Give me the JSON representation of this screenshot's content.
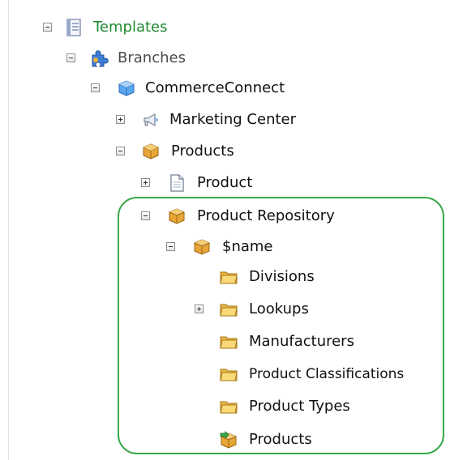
{
  "tree": {
    "templates": {
      "label": "Templates",
      "expanded": true
    },
    "branches": {
      "label": "Branches",
      "expanded": true
    },
    "commerce_connect": {
      "label": "CommerceConnect",
      "expanded": true
    },
    "marketing_center": {
      "label": "Marketing Center",
      "expanded": false
    },
    "products": {
      "label": "Products",
      "expanded": true
    },
    "product": {
      "label": "Product",
      "expanded": false
    },
    "product_repository": {
      "label": "Product Repository",
      "expanded": true
    },
    "name": {
      "label": "$name",
      "expanded": true
    },
    "divisions": {
      "label": "Divisions"
    },
    "lookups": {
      "label": "Lookups",
      "expanded": false
    },
    "manufacturers": {
      "label": "Manufacturers"
    },
    "product_classifications": {
      "label": "Product Classifications"
    },
    "product_types": {
      "label": "Product Types"
    },
    "products_child": {
      "label": "Products"
    }
  },
  "colors": {
    "templates_label": "#1f8a2e",
    "highlight": "#3aa84a"
  },
  "icons": {
    "templates": "template-document-icon",
    "branches": "branches-puzzle-icon",
    "commerce_connect": "blue-cube-icon",
    "marketing_center": "megaphone-icon",
    "products": "package-icon",
    "product": "page-icon",
    "product_repository": "package-icon",
    "name": "package-icon",
    "folder": "folder-icon",
    "products_child": "package-arrow-icon"
  }
}
